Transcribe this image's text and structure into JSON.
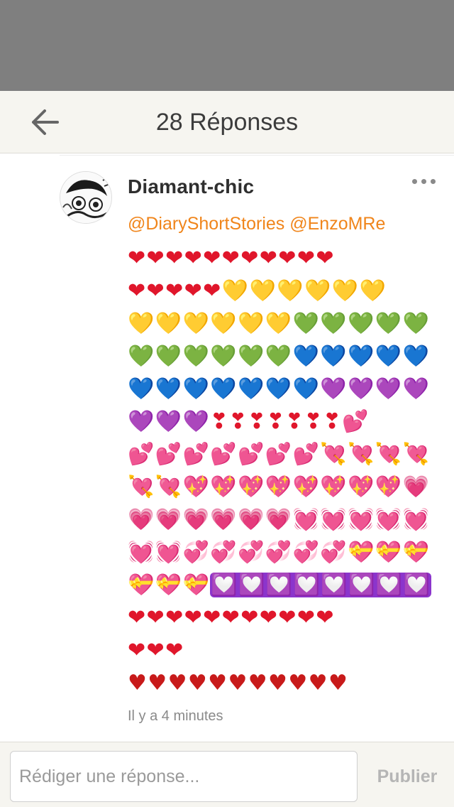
{
  "header": {
    "title": "28 Réponses",
    "back_icon": "arrow-left-icon"
  },
  "comment": {
    "username": "Diamant-chic",
    "mentions": [
      "@DiaryShortStories",
      "@EnzoMRe"
    ],
    "emoji_lines": [
      [
        {
          "c": "red",
          "t": "❤❤❤❤❤❤❤❤❤❤❤"
        }
      ],
      [
        {
          "c": "red",
          "t": "❤❤❤❤❤"
        },
        {
          "c": "yellow",
          "t": "💛💛💛💛💛💛"
        }
      ],
      [
        {
          "c": "yellow",
          "t": "💛💛💛💛💛💛"
        },
        {
          "c": "green",
          "t": "💚💚💚💚💚"
        }
      ],
      [
        {
          "c": "green",
          "t": "💚💚💚💚💚💚"
        },
        {
          "c": "blue",
          "t": "💙💙💙💙💙"
        }
      ],
      [
        {
          "c": "blue",
          "t": "💙💙💙💙💙💙💙"
        },
        {
          "c": "purple",
          "t": "💜💜💜💜"
        }
      ],
      [
        {
          "c": "purple",
          "t": "💜💜💜"
        },
        {
          "c": "excl",
          "t": "❣❣❣❣❣❣❣"
        },
        {
          "c": "pink",
          "t": "💕"
        }
      ],
      [
        {
          "c": "pink",
          "t": "💕💕💕💕💕💕💕💘💘💘💘"
        }
      ],
      [
        {
          "c": "pink",
          "t": "💘💘💖💖💖💖💖💖💖💖💗"
        }
      ],
      [
        {
          "c": "pink",
          "t": "💗💗💗💗💗💗💓💓💓💓💓"
        }
      ],
      [
        {
          "c": "pink",
          "t": "💓💓💞💞💞💞💞💞"
        },
        {
          "c": "gift",
          "t": "💝💝💝"
        }
      ],
      [
        {
          "c": "gift",
          "t": "💝💝💝"
        },
        {
          "c": "box",
          "t": "💟💟💟💟💟💟💟💟"
        }
      ],
      [
        {
          "c": "red",
          "t": "❤❤❤❤❤❤❤❤❤❤❤"
        }
      ],
      [
        {
          "c": "red",
          "t": "❤❤❤"
        }
      ],
      [
        {
          "c": "dark",
          "t": "♥♥♥♥♥♥♥♥♥♥♥"
        }
      ]
    ],
    "timestamp": "Il y a 4 minutes",
    "avatar_name": "avatar",
    "more_icon": "more-dots-icon"
  },
  "footer": {
    "reply_placeholder": "Rédiger une réponse...",
    "reply_value": "",
    "publish_label": "Publier"
  },
  "colors": {
    "accent": "#f0851b",
    "header_bg": "#f6f5f0",
    "status_bg": "#7f7f7f"
  }
}
